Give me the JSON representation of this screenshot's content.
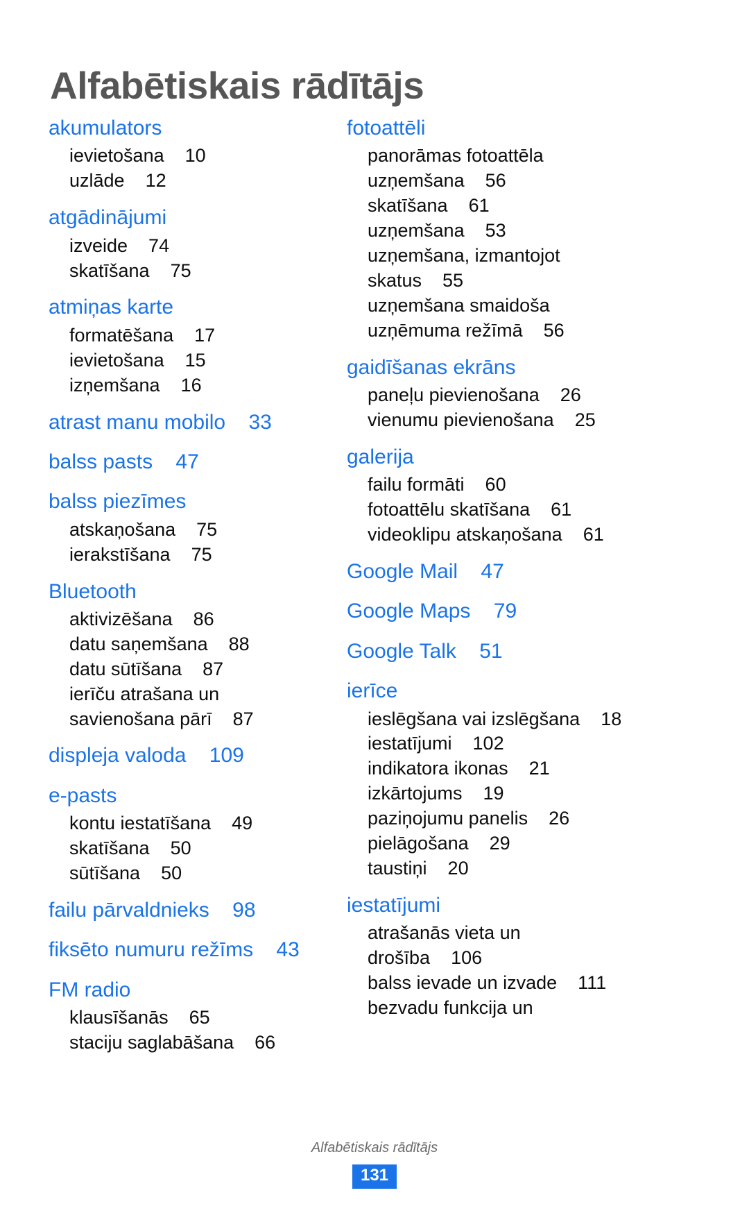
{
  "document": {
    "title": "Alfabētiskais rādītājs",
    "accent_color": "#1a73e8",
    "title_color": "#565656",
    "body_color": "#0d0d0d"
  },
  "footer": {
    "label": "Alfabētiskais rādītājs",
    "page_number": "131"
  },
  "columns": {
    "left": [
      {
        "head": "akumulators",
        "page": "",
        "subs": [
          "ievietošana    10",
          "uzlāde    12"
        ]
      },
      {
        "head": "atgādinājumi",
        "page": "",
        "subs": [
          "izveide    74",
          "skatīšana    75"
        ]
      },
      {
        "head": "atmiņas karte",
        "page": "",
        "subs": [
          "formatēšana    17",
          "ievietošana    15",
          "izņemšana    16"
        ]
      },
      {
        "head": "atrast manu mobilo",
        "page": "33",
        "subs": []
      },
      {
        "head": "balss pasts",
        "page": "47",
        "subs": []
      },
      {
        "head": "balss piezīmes",
        "page": "",
        "subs": [
          "atskaņošana    75",
          "ierakstīšana    75"
        ]
      },
      {
        "head": "Bluetooth",
        "page": "",
        "subs": [
          "aktivizēšana    86",
          "datu saņemšana    88",
          "datu sūtīšana    87",
          "ierīču atrašana un",
          "savienošana pārī    87"
        ]
      },
      {
        "head": "displeja valoda",
        "page": "109",
        "subs": []
      },
      {
        "head": "e-pasts",
        "page": "",
        "subs": [
          "kontu iestatīšana    49",
          "skatīšana    50",
          "sūtīšana    50"
        ]
      },
      {
        "head": "failu pārvaldnieks",
        "page": "98",
        "subs": []
      },
      {
        "head": "fiksēto numuru režīms",
        "page": "43",
        "subs": []
      },
      {
        "head": "FM radio",
        "page": "",
        "subs": [
          "klausīšanās    65",
          "staciju saglabāšana    66"
        ]
      }
    ],
    "right": [
      {
        "head": "fotoattēli",
        "page": "",
        "subs": [
          "panorāmas fotoattēla",
          "uzņemšana    56",
          "skatīšana    61",
          "uzņemšana    53",
          "uzņemšana, izmantojot",
          "skatus    55",
          "uzņemšana smaidoša",
          "uzņēmuma režīmā    56"
        ]
      },
      {
        "head": "gaidīšanas ekrāns",
        "page": "",
        "subs": [
          "paneļu pievienošana    26",
          "vienumu pievienošana    25"
        ]
      },
      {
        "head": "galerija",
        "page": "",
        "subs": [
          "failu formāti    60",
          "fotoattēlu skatīšana    61",
          "videoklipu atskaņošana    61"
        ]
      },
      {
        "head": "Google Mail",
        "page": "47",
        "subs": []
      },
      {
        "head": "Google Maps",
        "page": "79",
        "subs": []
      },
      {
        "head": "Google Talk",
        "page": "51",
        "subs": []
      },
      {
        "head": "ierīce",
        "page": "",
        "subs": [
          "ieslēgšana vai izslēgšana    18",
          "iestatījumi    102",
          "indikatora ikonas    21",
          "izkārtojums    19",
          "paziņojumu panelis    26",
          "pielāgošana    29",
          "taustiņi    20"
        ]
      },
      {
        "head": "iestatījumi",
        "page": "",
        "subs": [
          "atrašanās vieta un",
          "drošība    106",
          "balss ievade un izvade    111",
          "bezvadu funkcija un"
        ]
      }
    ]
  }
}
